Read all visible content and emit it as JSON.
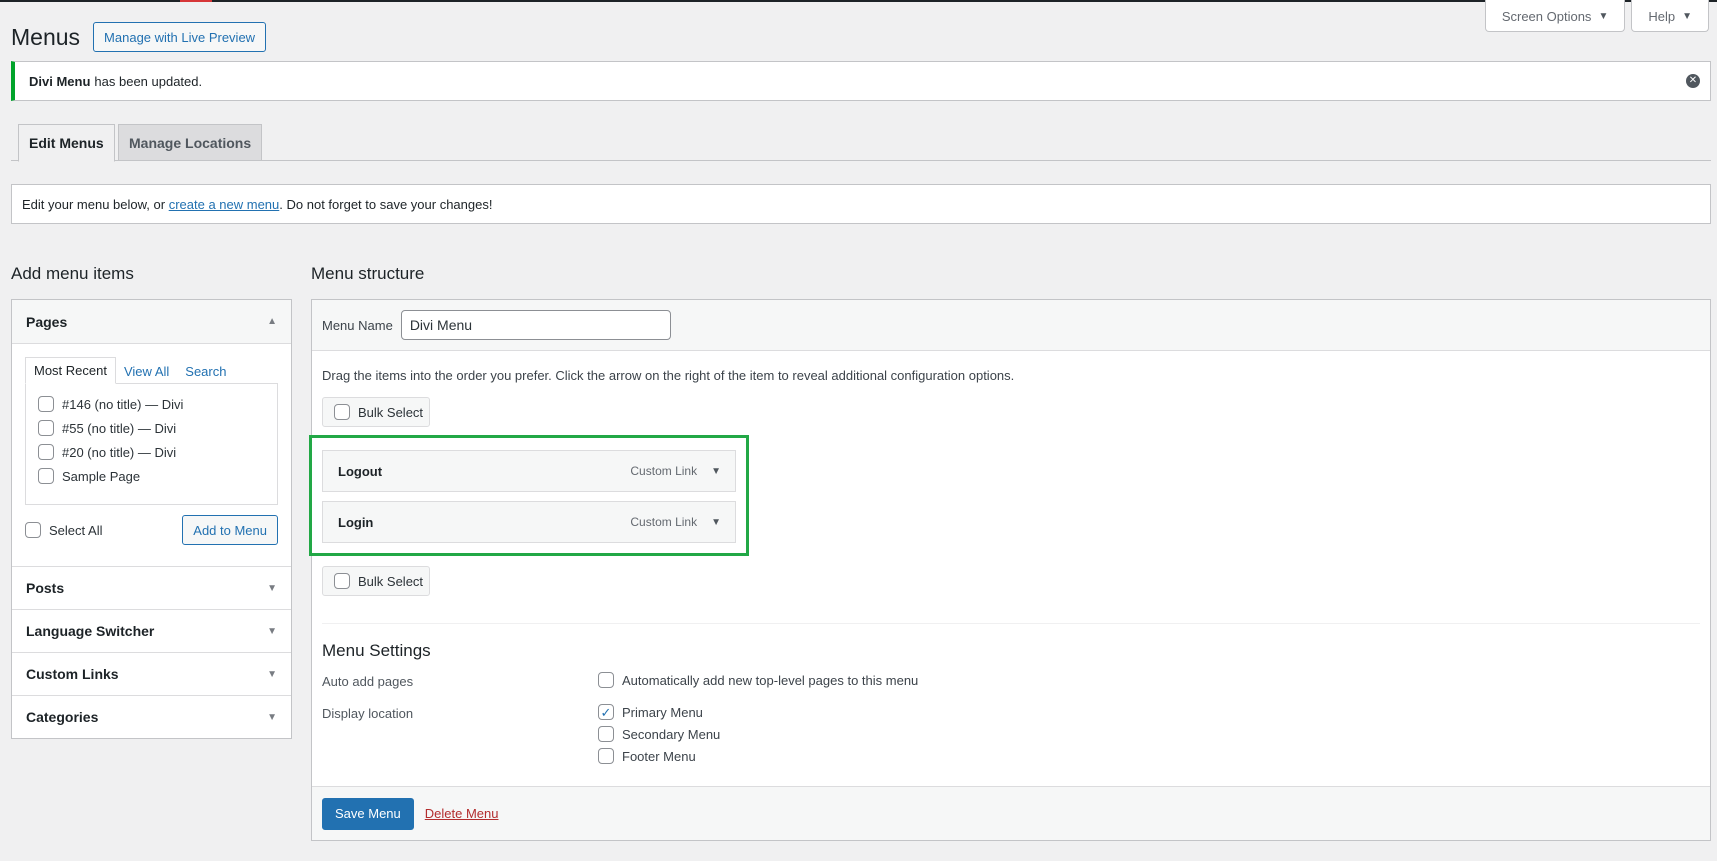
{
  "header": {
    "title": "Menus",
    "live_preview_label": "Manage with Live Preview",
    "screen_options_label": "Screen Options",
    "help_label": "Help"
  },
  "notice": {
    "menu_name": "Divi Menu",
    "text": "has been updated."
  },
  "tabs": [
    {
      "label": "Edit Menus",
      "active": true
    },
    {
      "label": "Manage Locations",
      "active": false
    }
  ],
  "manage": {
    "text_before": "Edit your menu below, or ",
    "link": "create a new menu",
    "text_after": ". Do not forget to save your changes!"
  },
  "add_items": {
    "heading": "Add menu items",
    "pages": {
      "title": "Pages",
      "tabs": [
        "Most Recent",
        "View All",
        "Search"
      ],
      "items": [
        {
          "label": "#146 (no title) — Divi",
          "checked": false
        },
        {
          "label": "#55 (no title) — Divi",
          "checked": false
        },
        {
          "label": "#20 (no title) — Divi",
          "checked": false
        },
        {
          "label": "Sample Page",
          "checked": false
        }
      ],
      "select_all": "Select All",
      "add_button": "Add to Menu"
    },
    "sections": [
      "Posts",
      "Language Switcher",
      "Custom Links",
      "Categories"
    ]
  },
  "structure": {
    "heading": "Menu structure",
    "name_label": "Menu Name",
    "name_value": "Divi Menu",
    "instructions": "Drag the items into the order you prefer. Click the arrow on the right of the item to reveal additional configuration options.",
    "bulk_select": "Bulk Select",
    "items": [
      {
        "title": "Logout",
        "type": "Custom Link"
      },
      {
        "title": "Login",
        "type": "Custom Link"
      }
    ],
    "settings": {
      "title": "Menu Settings",
      "auto_add_label": "Auto add pages",
      "auto_add_option": "Automatically add new top-level pages to this menu",
      "display_location_label": "Display location",
      "locations": [
        {
          "label": "Primary Menu",
          "checked": true
        },
        {
          "label": "Secondary Menu",
          "checked": false
        },
        {
          "label": "Footer Menu",
          "checked": false
        }
      ]
    },
    "save_label": "Save Menu",
    "delete_label": "Delete Menu"
  },
  "colors": {
    "accent": "#2271b1",
    "success": "#00a32a",
    "highlight": "#22a846",
    "danger": "#b32d2e"
  }
}
